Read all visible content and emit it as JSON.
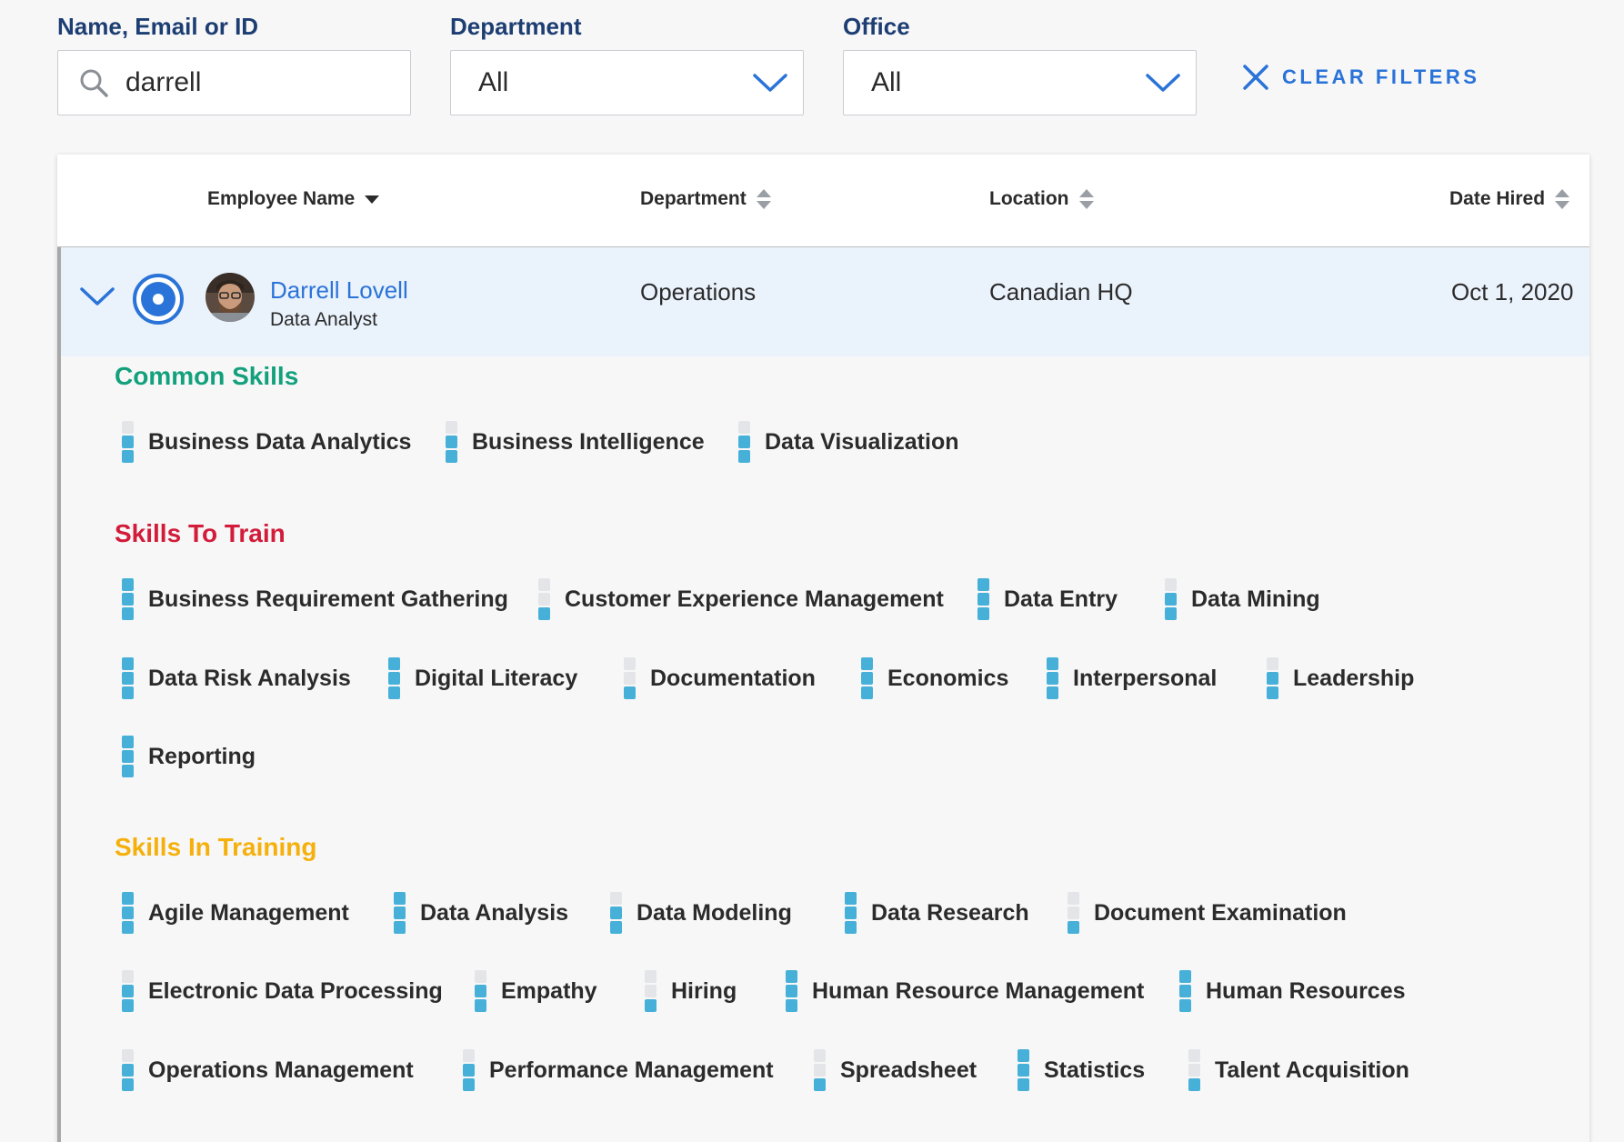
{
  "filters": {
    "name_label": "Name, Email or ID",
    "name_value": "darrell",
    "department_label": "Department",
    "department_value": "All",
    "office_label": "Office",
    "office_value": "All",
    "clear_label": "CLEAR FILTERS"
  },
  "table": {
    "columns": {
      "employee_name": "Employee Name",
      "department": "Department",
      "location": "Location",
      "date_hired": "Date Hired"
    },
    "row": {
      "name": "Darrell Lovell",
      "title": "Data Analyst",
      "department": "Operations",
      "location": "Canadian HQ",
      "date_hired": "Oct 1, 2020"
    }
  },
  "sections": {
    "common": {
      "title": "Common Skills",
      "color": "#13a07c",
      "skills": [
        {
          "name": "Business Data Analytics",
          "level": 2
        },
        {
          "name": "Business Intelligence",
          "level": 2
        },
        {
          "name": "Data Visualization",
          "level": 2
        }
      ]
    },
    "to_train": {
      "title": "Skills To Train",
      "color": "#d21c3a",
      "skills": [
        {
          "name": "Business Requirement Gathering",
          "level": 3
        },
        {
          "name": "Customer Experience Management",
          "level": 1
        },
        {
          "name": "Data Entry",
          "level": 3
        },
        {
          "name": "Data Mining",
          "level": 2
        },
        {
          "name": "Data Risk Analysis",
          "level": 3
        },
        {
          "name": "Digital Literacy",
          "level": 3
        },
        {
          "name": "Documentation",
          "level": 1
        },
        {
          "name": "Economics",
          "level": 3
        },
        {
          "name": "Interpersonal",
          "level": 3
        },
        {
          "name": "Leadership",
          "level": 2
        },
        {
          "name": "Reporting",
          "level": 3
        }
      ]
    },
    "in_training": {
      "title": "Skills In Training",
      "color": "#f5b00b",
      "skills": [
        {
          "name": "Agile Management",
          "level": 3
        },
        {
          "name": "Data Analysis",
          "level": 3
        },
        {
          "name": "Data Modeling",
          "level": 2
        },
        {
          "name": "Data Research",
          "level": 3
        },
        {
          "name": "Document Examination",
          "level": 1
        },
        {
          "name": "Electronic Data Processing",
          "level": 2
        },
        {
          "name": "Empathy",
          "level": 2
        },
        {
          "name": "Hiring",
          "level": 1
        },
        {
          "name": "Human Resource Management",
          "level": 3
        },
        {
          "name": "Human Resources",
          "level": 3
        },
        {
          "name": "Operations Management",
          "level": 2
        },
        {
          "name": "Performance Management",
          "level": 2
        },
        {
          "name": "Spreadsheet",
          "level": 1
        },
        {
          "name": "Statistics",
          "level": 3
        },
        {
          "name": "Talent Acquisition",
          "level": 1
        }
      ]
    }
  }
}
